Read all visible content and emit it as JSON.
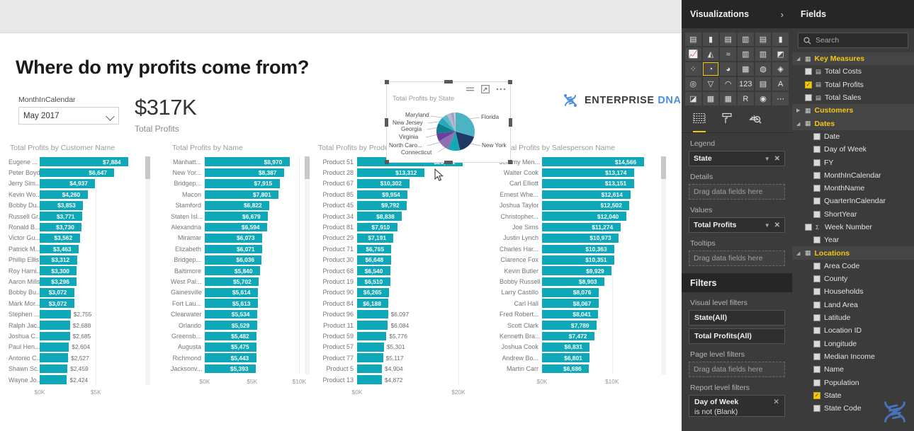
{
  "report": {
    "title": "Where do my profits come from?",
    "slicer": {
      "label": "MonthInCalendar",
      "value": "May 2017",
      "icon": "chevron-down-icon"
    },
    "kpi": {
      "value": "$317K",
      "label": "Total Profits"
    },
    "logo": {
      "word1": "ENTERPRISE",
      "word2": "DNA",
      "icon": "dna-helix-icon"
    }
  },
  "pie_visual": {
    "title": "Total Profits by State",
    "menu_icon": "ellipsis-icon",
    "focus_icon": "focus-mode-icon",
    "filter_icon": "filter-lines-icon",
    "labels_left": [
      "Maryland",
      "New Jersey",
      "Georgia",
      "Virginia",
      "North Caro...",
      "Connecticut"
    ],
    "labels_right": [
      "Florida",
      "New York"
    ]
  },
  "chart_data": [
    {
      "type": "bar",
      "title": "Total Profits by Customer Name",
      "xlabel": "",
      "ylabel": "",
      "orientation": "horizontal",
      "xlim": [
        0,
        8700
      ],
      "ticks": [
        "$0K",
        "$5K"
      ],
      "tick_values": [
        0,
        5000
      ],
      "categories": [
        "Eugene ...",
        "Peter Boyd",
        "Jerry Sim...",
        "Kevin Wo...",
        "Bobby Du...",
        "Russell Gr...",
        "Ronald B...",
        "Victor Gu...",
        "Patrick M...",
        "Phillip Ellis",
        "Roy Hami...",
        "Aaron Mills",
        "Bobby Bu...",
        "Mark Mor...",
        "Stephen ...",
        "Ralph Jac...",
        "Joshua C...",
        "Paul Hen...",
        "Antonio C...",
        "Shawn Sc...",
        "Wayne Jo..."
      ],
      "values": [
        7884,
        6647,
        4937,
        4260,
        3853,
        3771,
        3730,
        3562,
        3463,
        3312,
        3300,
        3296,
        3072,
        3072,
        2755,
        2688,
        2685,
        2604,
        2527,
        2459,
        2424
      ],
      "labels": [
        "$7,884",
        "$6,647",
        "$4,937",
        "$4,260",
        "$3,853",
        "$3,771",
        "$3,730",
        "$3,562",
        "$3,463",
        "$3,312",
        "$3,300",
        "$3,296",
        "$3,072",
        "$3,072",
        "$2,755",
        "$2,688",
        "$2,685",
        "$2,604",
        "$2,527",
        "$2,459",
        "$2,424"
      ]
    },
    {
      "type": "bar",
      "title": "Total Profits by Name",
      "xlabel": "",
      "ylabel": "",
      "orientation": "horizontal",
      "xlim": [
        0,
        9900
      ],
      "ticks": [
        "$0K",
        "$5K",
        "$10K"
      ],
      "tick_values": [
        0,
        5000,
        10000
      ],
      "categories": [
        "Manhatt...",
        "New Yor...",
        "Bridgep...",
        "Macon",
        "Stamford",
        "Staten Isl...",
        "Alexandria",
        "Miramar",
        "Elizabeth",
        "Bridgep...",
        "Baltimore",
        "West Pal...",
        "Gainesville",
        "Fort Lau...",
        "Clearwater",
        "Orlando",
        "Greensb...",
        "Augusta",
        "Richmond",
        "Jacksonv..."
      ],
      "values": [
        8970,
        8387,
        7915,
        7801,
        6822,
        6679,
        6594,
        6073,
        6071,
        6036,
        5840,
        5702,
        5614,
        5613,
        5534,
        5529,
        5482,
        5475,
        5443,
        5393
      ],
      "labels": [
        "$8,970",
        "$8,387",
        "$7,915",
        "$7,801",
        "$6,822",
        "$6,679",
        "$6,594",
        "$6,073",
        "$6,071",
        "$6,036",
        "$5,840",
        "$5,702",
        "$5,614",
        "$5,613",
        "$5,534",
        "$5,529",
        "$5,482",
        "$5,475",
        "$5,443",
        "$5,393"
      ]
    },
    {
      "type": "bar",
      "title": "Total Profits by Product Name",
      "xlabel": "",
      "ylabel": "",
      "orientation": "horizontal",
      "xlim": [
        0,
        23500
      ],
      "ticks": [
        "$0K",
        "$20K"
      ],
      "tick_values": [
        0,
        20000
      ],
      "categories": [
        "Product 51",
        "Product 28",
        "Product 67",
        "Product 85",
        "Product 45",
        "Product 34",
        "Product 81",
        "Product 29",
        "Product 71",
        "Product 30",
        "Product 68",
        "Product 19",
        "Product 90",
        "Product 84",
        "Product 96",
        "Product 11",
        "Product 59",
        "Product 57",
        "Product 77",
        "Product 5",
        "Product 13"
      ],
      "values": [
        20900,
        13312,
        10302,
        9954,
        9792,
        8838,
        7910,
        7191,
        6765,
        6648,
        6540,
        6510,
        6265,
        6188,
        6097,
        6084,
        5776,
        5301,
        5117,
        4904,
        4872
      ],
      "labels": [
        "$20,900",
        "$13,312",
        "$10,302",
        "$9,954",
        "$9,792",
        "$8,838",
        "$7,910",
        "$7,191",
        "$6,765",
        "$6,648",
        "$6,540",
        "$6,510",
        "$6,265",
        "$6,188",
        "$6,097",
        "$6,084",
        "$5,776",
        "$5,301",
        "$5,117",
        "$4,904",
        "$4,872"
      ]
    },
    {
      "type": "bar",
      "title": "Total Profits by Salesperson Name",
      "xlabel": "",
      "ylabel": "",
      "orientation": "horizontal",
      "xlim": [
        0,
        16200
      ],
      "ticks": [
        "$0K",
        "$10K"
      ],
      "tick_values": [
        0,
        10000
      ],
      "categories": [
        "Jeremy Men...",
        "Walter Cook",
        "Carl Elliott",
        "Ernest Whe...",
        "Joshua Taylor",
        "Christopher...",
        "Joe Sims",
        "Justin Lynch",
        "Charles Har...",
        "Clarence Fox",
        "Kevin Butler",
        "Bobby Russell",
        "Larry Castillo",
        "Carl Hall",
        "Fred Robert...",
        "Scott Clark",
        "Kenneth Bra...",
        "Joshua Cook",
        "Andrew Bo...",
        "Martin Carr"
      ],
      "values": [
        14566,
        13174,
        13151,
        12614,
        12502,
        12040,
        11274,
        10973,
        10363,
        10351,
        9929,
        8903,
        8076,
        8067,
        8041,
        7789,
        7472,
        6831,
        6801,
        6686
      ],
      "labels": [
        "$14,566",
        "$13,174",
        "$13,151",
        "$12,614",
        "$12,502",
        "$12,040",
        "$11,274",
        "$10,973",
        "$10,363",
        "$10,351",
        "$9,929",
        "$8,903",
        "$8,076",
        "$8,067",
        "$8,041",
        "$7,789",
        "$7,472",
        "$6,831",
        "$6,801",
        "$6,686"
      ]
    }
  ],
  "visualizations": {
    "header": "Visualizations",
    "collapse_icon": "chevron-right-icon",
    "icons": [
      "stacked-bar-chart-icon",
      "stacked-column-chart-icon",
      "clustered-bar-chart-icon",
      "clustered-column-chart-icon",
      "100-stacked-bar-chart-icon",
      "100-stacked-column-chart-icon",
      "line-chart-icon",
      "area-chart-icon",
      "stacked-area-chart-icon",
      "line-stacked-column-chart-icon",
      "line-clustered-column-chart-icon",
      "ribbon-chart-icon",
      "scatter-chart-icon",
      "pie-chart-icon",
      "donut-chart-icon",
      "treemap-icon",
      "map-icon",
      "filled-map-icon",
      "shape-map-icon",
      "funnel-icon",
      "gauge-icon",
      "card-icon",
      "multi-row-card-icon",
      "kpi-icon",
      "slicer-icon",
      "table-icon",
      "matrix-icon",
      "r-script-icon",
      "python-visual-icon",
      "more-options-icon"
    ],
    "selected_icon_index": 13,
    "tabs": [
      {
        "name": "fields-tab",
        "icon": "fields-table-icon",
        "active": true
      },
      {
        "name": "format-tab",
        "icon": "paint-roller-icon",
        "active": false
      },
      {
        "name": "analytics-tab",
        "icon": "magnifier-chart-icon",
        "active": false
      }
    ],
    "wells": [
      {
        "label": "Legend",
        "type": "chip",
        "value": "State"
      },
      {
        "label": "Details",
        "type": "drop",
        "value": "Drag data fields here"
      },
      {
        "label": "Values",
        "type": "chip",
        "value": "Total Profits"
      },
      {
        "label": "Tooltips",
        "type": "drop",
        "value": "Drag data fields here"
      }
    ]
  },
  "filters": {
    "header": "Filters",
    "visual_level_label": "Visual level filters",
    "visual_level_items": [
      "State(All)",
      "Total Profits(All)"
    ],
    "page_level_label": "Page level filters",
    "page_level_drop": "Drag data fields here",
    "report_level_label": "Report level filters",
    "report_level_item": {
      "name": "Day of Week",
      "condition": "is not (Blank)",
      "close_icon": "close-icon"
    }
  },
  "fields": {
    "header": "Fields",
    "search_placeholder": "Search",
    "search_icon": "search-icon",
    "tree": [
      {
        "name": "Key Measures",
        "kind": "table",
        "expanded": true,
        "indent": 0,
        "icon": "measures-table-icon"
      },
      {
        "name": "Total Costs",
        "kind": "measure",
        "checked": false,
        "indent": 1
      },
      {
        "name": "Total Profits",
        "kind": "measure",
        "checked": true,
        "indent": 1
      },
      {
        "name": "Total Sales",
        "kind": "measure",
        "checked": false,
        "indent": 1
      },
      {
        "name": "Customers",
        "kind": "table",
        "expanded": false,
        "indent": 0,
        "icon": "table-icon"
      },
      {
        "name": "Dates",
        "kind": "table",
        "expanded": true,
        "indent": 0,
        "icon": "table-icon"
      },
      {
        "name": "Date",
        "kind": "field",
        "checked": false,
        "indent": 2
      },
      {
        "name": "Day of Week",
        "kind": "field",
        "checked": false,
        "indent": 2
      },
      {
        "name": "FY",
        "kind": "field",
        "checked": false,
        "indent": 2
      },
      {
        "name": "MonthInCalendar",
        "kind": "field",
        "checked": false,
        "indent": 2
      },
      {
        "name": "MonthName",
        "kind": "field",
        "checked": false,
        "indent": 2
      },
      {
        "name": "QuarterInCalendar",
        "kind": "field",
        "checked": false,
        "indent": 2
      },
      {
        "name": "ShortYear",
        "kind": "field",
        "checked": false,
        "indent": 2
      },
      {
        "name": "Week Number",
        "kind": "field",
        "checked": false,
        "indent": 1,
        "sigma": true
      },
      {
        "name": "Year",
        "kind": "field",
        "checked": false,
        "indent": 2
      },
      {
        "name": "Locations",
        "kind": "table",
        "expanded": true,
        "indent": 0,
        "icon": "table-icon"
      },
      {
        "name": "Area Code",
        "kind": "field",
        "checked": false,
        "indent": 2
      },
      {
        "name": "County",
        "kind": "field",
        "checked": false,
        "indent": 2
      },
      {
        "name": "Households",
        "kind": "field",
        "checked": false,
        "indent": 2
      },
      {
        "name": "Land Area",
        "kind": "field",
        "checked": false,
        "indent": 2
      },
      {
        "name": "Latitude",
        "kind": "field",
        "checked": false,
        "indent": 2
      },
      {
        "name": "Location ID",
        "kind": "field",
        "checked": false,
        "indent": 2
      },
      {
        "name": "Longitude",
        "kind": "field",
        "checked": false,
        "indent": 2
      },
      {
        "name": "Median Income",
        "kind": "field",
        "checked": false,
        "indent": 2
      },
      {
        "name": "Name",
        "kind": "field",
        "checked": false,
        "indent": 2
      },
      {
        "name": "Population",
        "kind": "field",
        "checked": false,
        "indent": 2
      },
      {
        "name": "State",
        "kind": "field",
        "checked": true,
        "indent": 2
      },
      {
        "name": "State Code",
        "kind": "field",
        "checked": false,
        "indent": 2
      }
    ]
  },
  "theme": {
    "bar_color": "#0fa8b9",
    "accent_yellow": "#f2c811",
    "pane_bg": "#3b3b3b",
    "pie_colors": [
      "#4cb3c4",
      "#1f3864",
      "#17a8b8",
      "#7e63a8",
      "#8e6fb0",
      "#6b3fa0",
      "#0f7f8f",
      "#2aa8b8",
      "#5bbcc9",
      "#b8b8d0",
      "#9aa3c0"
    ]
  }
}
